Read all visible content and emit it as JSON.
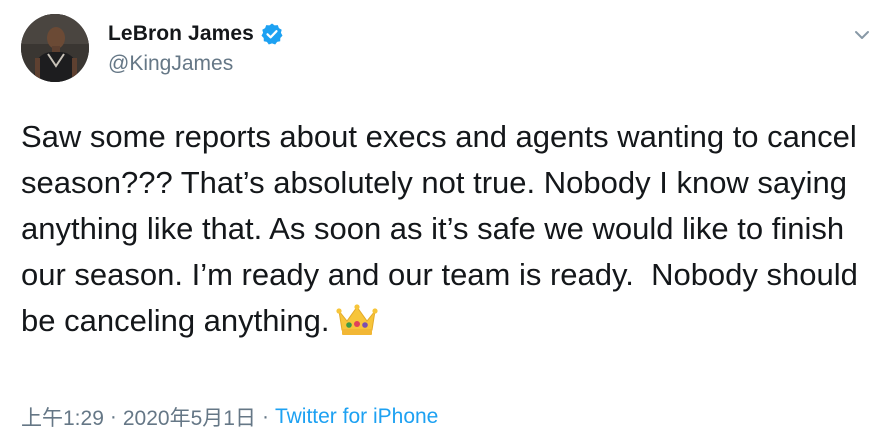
{
  "tweet": {
    "author": {
      "display_name": "LeBron James",
      "handle": "@KingJames",
      "verified": true,
      "avatar_icon": "profile-photo"
    },
    "text": "Saw some reports about execs and agents wanting to cancel season??? That’s absolutely not true. Nobody I know saying anything like that. As soon as it’s safe we would like to finish our season. I’m ready and our team is ready.  Nobody should be canceling anything.",
    "emoji": "crown",
    "time": "上午1:29",
    "separator": "·",
    "date": "2020年5月1日",
    "source": "Twitter for iPhone",
    "menu_icon": "chevron-down-icon"
  },
  "colors": {
    "link": "#1da1f2",
    "secondary_text": "#657786",
    "primary_text": "#14171a"
  }
}
